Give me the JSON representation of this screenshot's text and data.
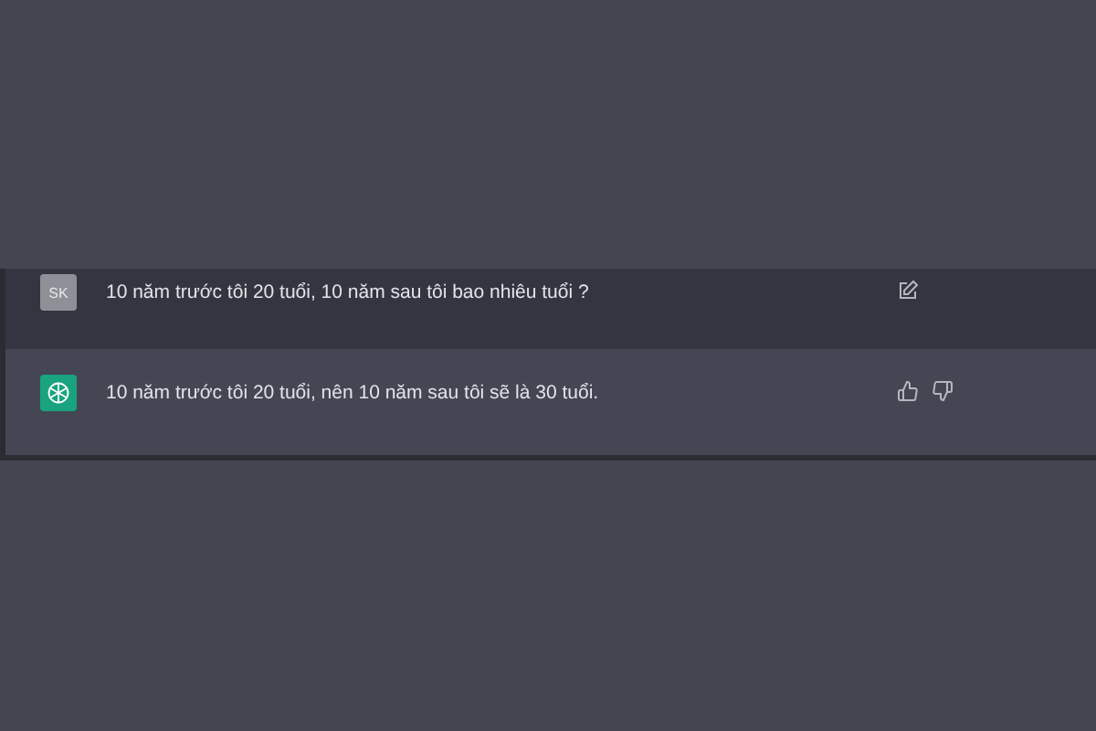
{
  "messages": [
    {
      "kind": "user",
      "avatar": "SK",
      "text": "10 năm trước tôi 20 tuổi, 10 năm sau tôi bao nhiêu tuổi ?"
    },
    {
      "kind": "assistant",
      "text": "10 năm trước tôi 20 tuổi, nên 10 năm sau tôi sẽ là 30 tuổi."
    }
  ]
}
